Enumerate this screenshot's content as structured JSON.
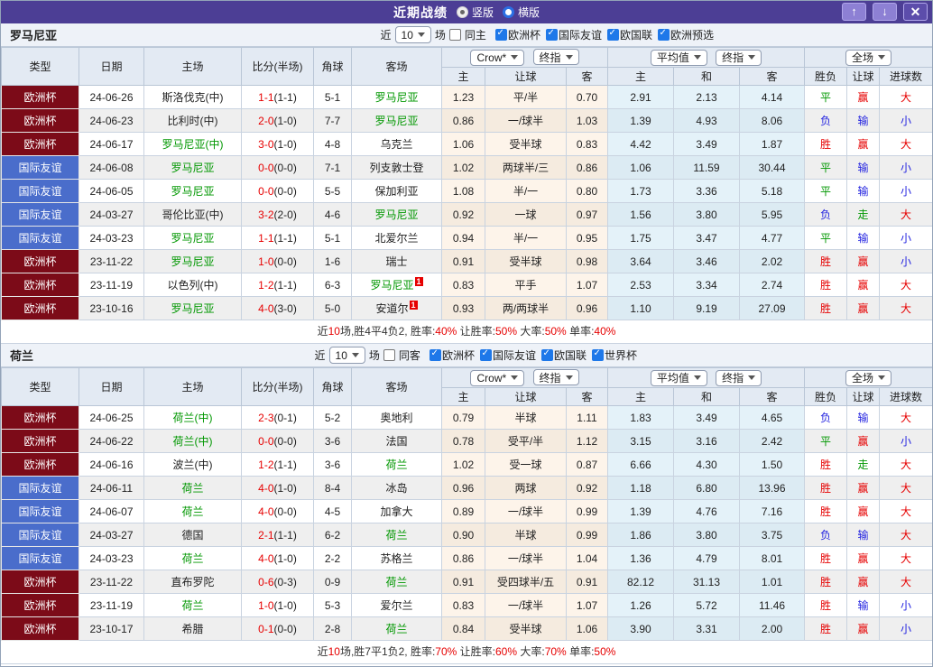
{
  "titlebar": {
    "title": "近期战绩",
    "vertical_label": "竖版",
    "horizontal_label": "横版",
    "selected": "竖版",
    "up_icon": "↑",
    "down_icon": "↓",
    "close_icon": "✕"
  },
  "colors": {
    "titlebar_purple": "#4c3e95",
    "euro_league_bg": "#7c0b18",
    "friendly_league_bg": "#4a6dcb",
    "team_green": "#009700",
    "win_red": "#e60000",
    "lose_blue": "#2424e0",
    "odds_bg": "#fdf4ea",
    "avg_bg": "#e4f2f9",
    "checkbox_blue": "#1e78e9"
  },
  "columns": {
    "type": "类型",
    "date": "日期",
    "home": "主场",
    "score": "比分(半场)",
    "corner": "角球",
    "away": "客场",
    "bookmaker_select": "Crow*",
    "final_select": "终指",
    "odds_home": "主",
    "odds_handicap": "让球",
    "odds_away": "客",
    "avg_select": "平均值",
    "avg_final_select": "终指",
    "avg_home": "主",
    "avg_draw": "和",
    "avg_away": "客",
    "scope_select": "全场",
    "result_wl": "胜负",
    "result_handicap": "让球",
    "result_goals": "进球数"
  },
  "sections": [
    {
      "team": "罗马尼亚",
      "filter": {
        "near": "近",
        "games": "10",
        "suffix": "场",
        "same_label": "同主",
        "same_checked": false,
        "leagues": [
          "欧洲杯",
          "国际友谊",
          "欧国联",
          "欧洲预选"
        ]
      },
      "rows": [
        {
          "league": "欧洲杯",
          "league_type": "euro",
          "date": "24-06-26",
          "home": "斯洛伐克(中)",
          "home_green": false,
          "home_badge": "",
          "score": "1-1",
          "half": "(1-1)",
          "corner": "5-1",
          "away": "罗马尼亚",
          "away_green": true,
          "away_badge": "",
          "o1": "1.23",
          "o2": "平/半",
          "o3": "0.70",
          "a1": "2.91",
          "a2": "2.13",
          "a3": "4.14",
          "r1": "平",
          "r1c": "g",
          "r2": "赢",
          "r2c": "r",
          "r3": "大",
          "r3c": "r"
        },
        {
          "league": "欧洲杯",
          "league_type": "euro",
          "date": "24-06-23",
          "home": "比利时(中)",
          "home_green": false,
          "home_badge": "",
          "score": "2-0",
          "half": "(1-0)",
          "corner": "7-7",
          "away": "罗马尼亚",
          "away_green": true,
          "away_badge": "",
          "o1": "0.86",
          "o2": "一/球半",
          "o3": "1.03",
          "a1": "1.39",
          "a2": "4.93",
          "a3": "8.06",
          "r1": "负",
          "r1c": "b",
          "r2": "输",
          "r2c": "b",
          "r3": "小",
          "r3c": "b"
        },
        {
          "league": "欧洲杯",
          "league_type": "euro",
          "date": "24-06-17",
          "home": "罗马尼亚(中)",
          "home_green": true,
          "home_badge": "",
          "score": "3-0",
          "half": "(1-0)",
          "corner": "4-8",
          "away": "乌克兰",
          "away_green": false,
          "away_badge": "",
          "o1": "1.06",
          "o2": "受半球",
          "o3": "0.83",
          "a1": "4.42",
          "a2": "3.49",
          "a3": "1.87",
          "r1": "胜",
          "r1c": "r",
          "r2": "赢",
          "r2c": "r",
          "r3": "大",
          "r3c": "r"
        },
        {
          "league": "国际友谊",
          "league_type": "friendly",
          "date": "24-06-08",
          "home": "罗马尼亚",
          "home_green": true,
          "home_badge": "",
          "score": "0-0",
          "half": "(0-0)",
          "corner": "7-1",
          "away": "列支敦士登",
          "away_green": false,
          "away_badge": "",
          "o1": "1.02",
          "o2": "两球半/三",
          "o3": "0.86",
          "a1": "1.06",
          "a2": "11.59",
          "a3": "30.44",
          "r1": "平",
          "r1c": "g",
          "r2": "输",
          "r2c": "b",
          "r3": "小",
          "r3c": "b"
        },
        {
          "league": "国际友谊",
          "league_type": "friendly",
          "date": "24-06-05",
          "home": "罗马尼亚",
          "home_green": true,
          "home_badge": "",
          "score": "0-0",
          "half": "(0-0)",
          "corner": "5-5",
          "away": "保加利亚",
          "away_green": false,
          "away_badge": "",
          "o1": "1.08",
          "o2": "半/一",
          "o3": "0.80",
          "a1": "1.73",
          "a2": "3.36",
          "a3": "5.18",
          "r1": "平",
          "r1c": "g",
          "r2": "输",
          "r2c": "b",
          "r3": "小",
          "r3c": "b"
        },
        {
          "league": "国际友谊",
          "league_type": "friendly",
          "date": "24-03-27",
          "home": "哥伦比亚(中)",
          "home_green": false,
          "home_badge": "",
          "score": "3-2",
          "half": "(2-0)",
          "corner": "4-6",
          "away": "罗马尼亚",
          "away_green": true,
          "away_badge": "",
          "o1": "0.92",
          "o2": "一球",
          "o3": "0.97",
          "a1": "1.56",
          "a2": "3.80",
          "a3": "5.95",
          "r1": "负",
          "r1c": "b",
          "r2": "走",
          "r2c": "g",
          "r3": "大",
          "r3c": "r"
        },
        {
          "league": "国际友谊",
          "league_type": "friendly",
          "date": "24-03-23",
          "home": "罗马尼亚",
          "home_green": true,
          "home_badge": "",
          "score": "1-1",
          "half": "(1-1)",
          "corner": "5-1",
          "away": "北爱尔兰",
          "away_green": false,
          "away_badge": "",
          "o1": "0.94",
          "o2": "半/一",
          "o3": "0.95",
          "a1": "1.75",
          "a2": "3.47",
          "a3": "4.77",
          "r1": "平",
          "r1c": "g",
          "r2": "输",
          "r2c": "b",
          "r3": "小",
          "r3c": "b"
        },
        {
          "league": "欧洲杯",
          "league_type": "euro",
          "date": "23-11-22",
          "home": "罗马尼亚",
          "home_green": true,
          "home_badge": "",
          "score": "1-0",
          "half": "(0-0)",
          "corner": "1-6",
          "away": "瑞士",
          "away_green": false,
          "away_badge": "",
          "o1": "0.91",
          "o2": "受半球",
          "o3": "0.98",
          "a1": "3.64",
          "a2": "3.46",
          "a3": "2.02",
          "r1": "胜",
          "r1c": "r",
          "r2": "赢",
          "r2c": "r",
          "r3": "小",
          "r3c": "b"
        },
        {
          "league": "欧洲杯",
          "league_type": "euro",
          "date": "23-11-19",
          "home": "以色列(中)",
          "home_green": false,
          "home_badge": "",
          "score": "1-2",
          "half": "(1-1)",
          "corner": "6-3",
          "away": "罗马尼亚",
          "away_green": true,
          "away_badge": "1",
          "o1": "0.83",
          "o2": "平手",
          "o3": "1.07",
          "a1": "2.53",
          "a2": "3.34",
          "a3": "2.74",
          "r1": "胜",
          "r1c": "r",
          "r2": "赢",
          "r2c": "r",
          "r3": "大",
          "r3c": "r"
        },
        {
          "league": "欧洲杯",
          "league_type": "euro",
          "date": "23-10-16",
          "home": "罗马尼亚",
          "home_green": true,
          "home_badge": "",
          "score": "4-0",
          "half": "(3-0)",
          "corner": "5-0",
          "away": "安道尔",
          "away_green": false,
          "away_badge": "1",
          "o1": "0.93",
          "o2": "两/两球半",
          "o3": "0.96",
          "a1": "1.10",
          "a2": "9.19",
          "a3": "27.09",
          "r1": "胜",
          "r1c": "r",
          "r2": "赢",
          "r2c": "r",
          "r3": "大",
          "r3c": "r"
        }
      ],
      "summary": [
        {
          "text": "近",
          "red": false
        },
        {
          "text": "10",
          "red": true
        },
        {
          "text": "场,胜4平4负2, 胜率:",
          "red": false
        },
        {
          "text": "40%",
          "red": true
        },
        {
          "text": " 让胜率:",
          "red": false
        },
        {
          "text": "50%",
          "red": true
        },
        {
          "text": " 大率:",
          "red": false
        },
        {
          "text": "50%",
          "red": true
        },
        {
          "text": " 单率:",
          "red": false
        },
        {
          "text": "40%",
          "red": true
        }
      ]
    },
    {
      "team": "荷兰",
      "filter": {
        "near": "近",
        "games": "10",
        "suffix": "场",
        "same_label": "同客",
        "same_checked": false,
        "leagues": [
          "欧洲杯",
          "国际友谊",
          "欧国联",
          "世界杯"
        ]
      },
      "rows": [
        {
          "league": "欧洲杯",
          "league_type": "euro",
          "date": "24-06-25",
          "home": "荷兰(中)",
          "home_green": true,
          "home_badge": "",
          "score": "2-3",
          "half": "(0-1)",
          "corner": "5-2",
          "away": "奥地利",
          "away_green": false,
          "away_badge": "",
          "o1": "0.79",
          "o2": "半球",
          "o3": "1.11",
          "a1": "1.83",
          "a2": "3.49",
          "a3": "4.65",
          "r1": "负",
          "r1c": "b",
          "r2": "输",
          "r2c": "b",
          "r3": "大",
          "r3c": "r"
        },
        {
          "league": "欧洲杯",
          "league_type": "euro",
          "date": "24-06-22",
          "home": "荷兰(中)",
          "home_green": true,
          "home_badge": "",
          "score": "0-0",
          "half": "(0-0)",
          "corner": "3-6",
          "away": "法国",
          "away_green": false,
          "away_badge": "",
          "o1": "0.78",
          "o2": "受平/半",
          "o3": "1.12",
          "a1": "3.15",
          "a2": "3.16",
          "a3": "2.42",
          "r1": "平",
          "r1c": "g",
          "r2": "赢",
          "r2c": "r",
          "r3": "小",
          "r3c": "b"
        },
        {
          "league": "欧洲杯",
          "league_type": "euro",
          "date": "24-06-16",
          "home": "波兰(中)",
          "home_green": false,
          "home_badge": "",
          "score": "1-2",
          "half": "(1-1)",
          "corner": "3-6",
          "away": "荷兰",
          "away_green": true,
          "away_badge": "",
          "o1": "1.02",
          "o2": "受一球",
          "o3": "0.87",
          "a1": "6.66",
          "a2": "4.30",
          "a3": "1.50",
          "r1": "胜",
          "r1c": "r",
          "r2": "走",
          "r2c": "g",
          "r3": "大",
          "r3c": "r"
        },
        {
          "league": "国际友谊",
          "league_type": "friendly",
          "date": "24-06-11",
          "home": "荷兰",
          "home_green": true,
          "home_badge": "",
          "score": "4-0",
          "half": "(1-0)",
          "corner": "8-4",
          "away": "冰岛",
          "away_green": false,
          "away_badge": "",
          "o1": "0.96",
          "o2": "两球",
          "o3": "0.92",
          "a1": "1.18",
          "a2": "6.80",
          "a3": "13.96",
          "r1": "胜",
          "r1c": "r",
          "r2": "赢",
          "r2c": "r",
          "r3": "大",
          "r3c": "r"
        },
        {
          "league": "国际友谊",
          "league_type": "friendly",
          "date": "24-06-07",
          "home": "荷兰",
          "home_green": true,
          "home_badge": "",
          "score": "4-0",
          "half": "(0-0)",
          "corner": "4-5",
          "away": "加拿大",
          "away_green": false,
          "away_badge": "",
          "o1": "0.89",
          "o2": "一/球半",
          "o3": "0.99",
          "a1": "1.39",
          "a2": "4.76",
          "a3": "7.16",
          "r1": "胜",
          "r1c": "r",
          "r2": "赢",
          "r2c": "r",
          "r3": "大",
          "r3c": "r"
        },
        {
          "league": "国际友谊",
          "league_type": "friendly",
          "date": "24-03-27",
          "home": "德国",
          "home_green": false,
          "home_badge": "",
          "score": "2-1",
          "half": "(1-1)",
          "corner": "6-2",
          "away": "荷兰",
          "away_green": true,
          "away_badge": "",
          "o1": "0.90",
          "o2": "半球",
          "o3": "0.99",
          "a1": "1.86",
          "a2": "3.80",
          "a3": "3.75",
          "r1": "负",
          "r1c": "b",
          "r2": "输",
          "r2c": "b",
          "r3": "大",
          "r3c": "r"
        },
        {
          "league": "国际友谊",
          "league_type": "friendly",
          "date": "24-03-23",
          "home": "荷兰",
          "home_green": true,
          "home_badge": "",
          "score": "4-0",
          "half": "(1-0)",
          "corner": "2-2",
          "away": "苏格兰",
          "away_green": false,
          "away_badge": "",
          "o1": "0.86",
          "o2": "一/球半",
          "o3": "1.04",
          "a1": "1.36",
          "a2": "4.79",
          "a3": "8.01",
          "r1": "胜",
          "r1c": "r",
          "r2": "赢",
          "r2c": "r",
          "r3": "大",
          "r3c": "r"
        },
        {
          "league": "欧洲杯",
          "league_type": "euro",
          "date": "23-11-22",
          "home": "直布罗陀",
          "home_green": false,
          "home_badge": "",
          "score": "0-6",
          "half": "(0-3)",
          "corner": "0-9",
          "away": "荷兰",
          "away_green": true,
          "away_badge": "",
          "o1": "0.91",
          "o2": "受四球半/五",
          "o3": "0.91",
          "a1": "82.12",
          "a2": "31.13",
          "a3": "1.01",
          "r1": "胜",
          "r1c": "r",
          "r2": "赢",
          "r2c": "r",
          "r3": "大",
          "r3c": "r"
        },
        {
          "league": "欧洲杯",
          "league_type": "euro",
          "date": "23-11-19",
          "home": "荷兰",
          "home_green": true,
          "home_badge": "",
          "score": "1-0",
          "half": "(1-0)",
          "corner": "5-3",
          "away": "爱尔兰",
          "away_green": false,
          "away_badge": "",
          "o1": "0.83",
          "o2": "一/球半",
          "o3": "1.07",
          "a1": "1.26",
          "a2": "5.72",
          "a3": "11.46",
          "r1": "胜",
          "r1c": "r",
          "r2": "输",
          "r2c": "b",
          "r3": "小",
          "r3c": "b"
        },
        {
          "league": "欧洲杯",
          "league_type": "euro",
          "date": "23-10-17",
          "home": "希腊",
          "home_green": false,
          "home_badge": "",
          "score": "0-1",
          "half": "(0-0)",
          "corner": "2-8",
          "away": "荷兰",
          "away_green": true,
          "away_badge": "",
          "o1": "0.84",
          "o2": "受半球",
          "o3": "1.06",
          "a1": "3.90",
          "a2": "3.31",
          "a3": "2.00",
          "r1": "胜",
          "r1c": "r",
          "r2": "赢",
          "r2c": "r",
          "r3": "小",
          "r3c": "b"
        }
      ],
      "summary": [
        {
          "text": "近",
          "red": false
        },
        {
          "text": "10",
          "red": true
        },
        {
          "text": "场,胜7平1负2, 胜率:",
          "red": false
        },
        {
          "text": "70%",
          "red": true
        },
        {
          "text": " 让胜率:",
          "red": false
        },
        {
          "text": "60%",
          "red": true
        },
        {
          "text": " 大率:",
          "red": false
        },
        {
          "text": "70%",
          "red": true
        },
        {
          "text": " 单率:",
          "red": false
        },
        {
          "text": "50%",
          "red": true
        }
      ]
    }
  ]
}
